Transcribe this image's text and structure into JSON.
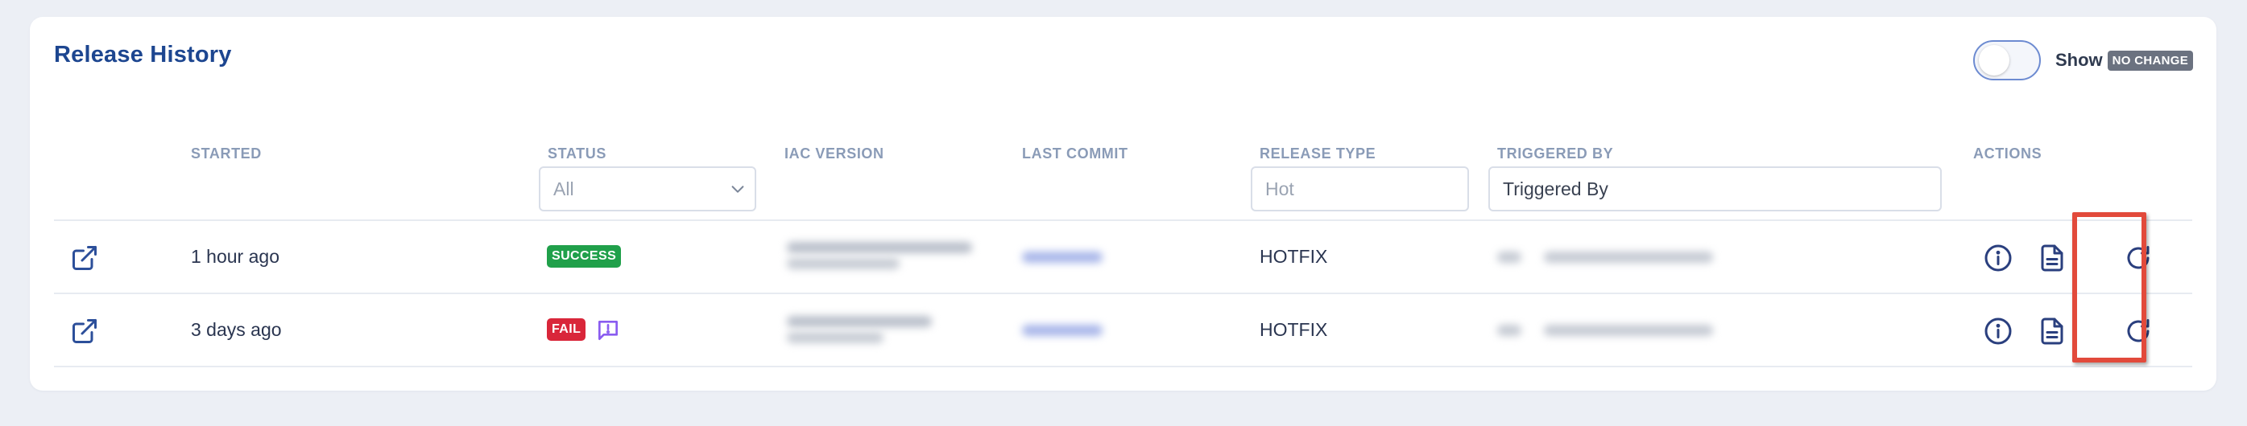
{
  "page": {
    "title": "Release History",
    "toggle": {
      "label": "Show",
      "badge": "NO CHANGE",
      "state": "off"
    }
  },
  "table": {
    "columns": [
      {
        "key": "expand",
        "label": ""
      },
      {
        "key": "started",
        "label": "STARTED"
      },
      {
        "key": "status",
        "label": "STATUS"
      },
      {
        "key": "iac_version",
        "label": "IAC VERSION"
      },
      {
        "key": "last_commit",
        "label": "LAST COMMIT"
      },
      {
        "key": "release_type",
        "label": "RELEASE TYPE"
      },
      {
        "key": "triggered_by",
        "label": "TRIGGERED BY"
      },
      {
        "key": "actions",
        "label": "ACTIONS"
      }
    ],
    "filters": {
      "status": {
        "value": "All"
      },
      "release_type": {
        "placeholder": "Hot"
      },
      "triggered_by": {
        "placeholder": "Triggered By"
      }
    },
    "rows": [
      {
        "started": "1 hour ago",
        "status": "SUCCESS",
        "release_type": "HOTFIX",
        "actions": [
          "info-icon",
          "document-icon",
          "retry-icon"
        ]
      },
      {
        "started": "3 days ago",
        "status": "FAIL",
        "release_type": "HOTFIX",
        "has_comment": true,
        "actions": [
          "info-icon",
          "document-icon",
          "retry-icon"
        ]
      }
    ]
  },
  "colors": {
    "accent": "#1d4690",
    "success": "#20a04a",
    "fail": "#d9263a",
    "highlight": "#e24a3b",
    "badge_gray": "#6b7280"
  }
}
